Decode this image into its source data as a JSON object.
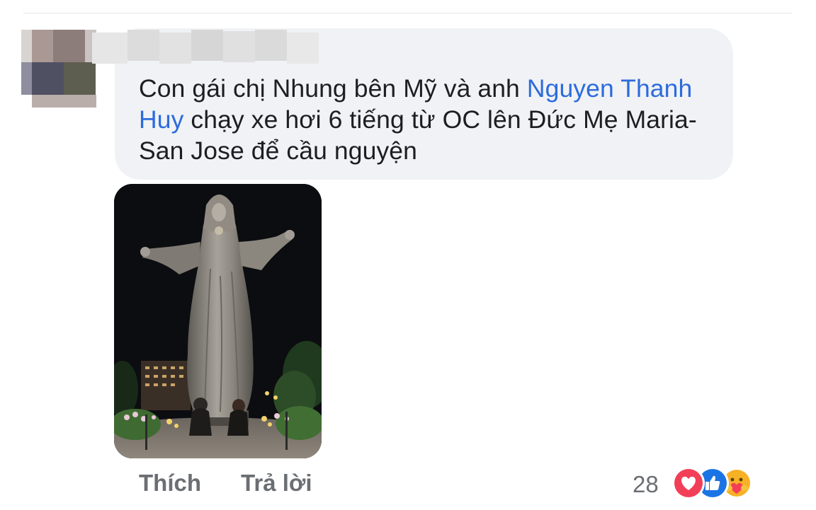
{
  "comment": {
    "text_before": "Con gái chị Nhung bên Mỹ và anh ",
    "mention": "Nguyen Thanh Huy",
    "text_after": " chạy xe hơi 6 tiếng từ OC lên Đức Mẹ Maria- San Jose để cầu nguyện"
  },
  "actions": {
    "like_label": "Thích",
    "reply_label": "Trả lời"
  },
  "reactions": {
    "count": "28",
    "icons": [
      "love-icon",
      "like-icon",
      "care-icon"
    ]
  },
  "colors": {
    "mention": "#2d6bdc",
    "bubble": "#f0f2f5",
    "action_text": "#6b6e73",
    "love": "#f33e58",
    "like": "#1b74e4",
    "care": "#f7b125"
  }
}
